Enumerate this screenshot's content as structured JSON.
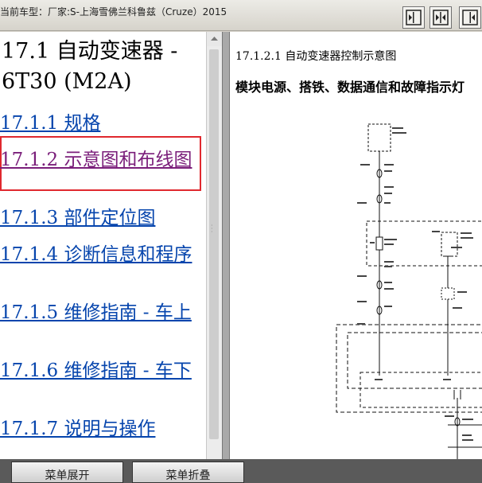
{
  "window": {
    "title": "当前车型：厂家:S-上海雪佛兰科鲁兹（Cruze）2015"
  },
  "toolbar": {
    "buttons": [
      {
        "name": "left-pane-toggle",
        "icon": "arrow-left-icon"
      },
      {
        "name": "both-panes-toggle",
        "icon": "arrows-horizontal-icon"
      },
      {
        "name": "right-pane-toggle",
        "icon": "arrow-right-icon"
      }
    ]
  },
  "toc": {
    "title": "17.1 自动变速器 - 6T30 (M2A)",
    "items": [
      {
        "label": "17.1.1 规格",
        "visited": false
      },
      {
        "label": "17.1.2 示意图和布线图",
        "visited": true,
        "highlighted": true
      },
      {
        "label": "17.1.3 部件定位图",
        "visited": false
      },
      {
        "label": "17.1.4 诊断信息和程序",
        "visited": false
      },
      {
        "label": "17.1.5 维修指南 - 车上",
        "visited": false
      },
      {
        "label": "17.1.6 维修指南 - 车下",
        "visited": false
      },
      {
        "label": "17.1.7 说明与操作",
        "visited": false
      }
    ]
  },
  "content": {
    "section_heading": "17.1.2.1 自动变速器控制示意图",
    "subheading": "模块电源、搭铁、数据通信和故障指示灯"
  },
  "bottom_bar": {
    "expand_label": "菜单展开",
    "collapse_label": "菜单折叠"
  },
  "colors": {
    "link": "#0645ad",
    "visited_link": "#7a1e7a",
    "highlight_border": "#e0282e"
  }
}
